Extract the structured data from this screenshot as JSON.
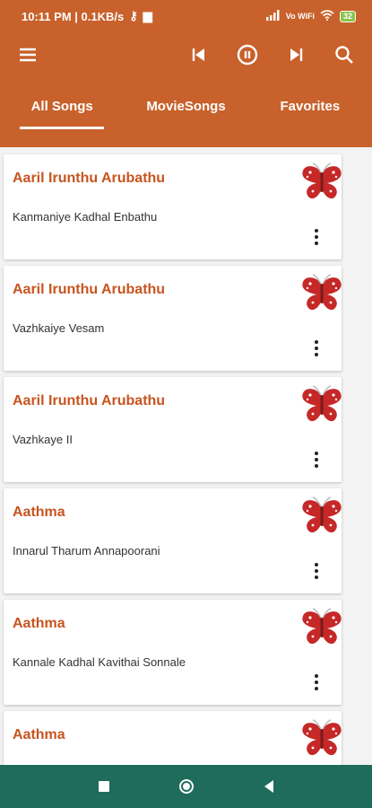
{
  "status": {
    "time_speed": "10:11 PM | 0.1KB/s",
    "network": "Vo WiFi",
    "battery": "32"
  },
  "tabs": [
    {
      "label": "All Songs",
      "active": true
    },
    {
      "label": "MovieSongs",
      "active": false
    },
    {
      "label": "Favorites",
      "active": false
    }
  ],
  "songs": [
    {
      "title": "Aaril Irunthu Arubathu",
      "subtitle": "Kanmaniye Kadhal Enbathu"
    },
    {
      "title": "Aaril Irunthu Arubathu",
      "subtitle": "Vazhkaiye Vesam"
    },
    {
      "title": "Aaril Irunthu Arubathu",
      "subtitle": "Vazhkaye II"
    },
    {
      "title": "Aathma",
      "subtitle": "Innarul Tharum Annapoorani"
    },
    {
      "title": "Aathma",
      "subtitle": "Kannale Kadhal Kavithai Sonnale"
    },
    {
      "title": "Aathma",
      "subtitle": ""
    }
  ],
  "colors": {
    "primary": "#c8612b",
    "title_text": "#c8541f",
    "favorite_icon": "#c62828",
    "nav_bar": "#1f6b5c"
  },
  "icons": {
    "menu": "menu-icon",
    "previous": "skip-previous-icon",
    "pause": "pause-circle-icon",
    "next": "skip-next-icon",
    "search": "search-icon",
    "favorite": "butterfly-icon",
    "more": "more-vertical-icon"
  }
}
